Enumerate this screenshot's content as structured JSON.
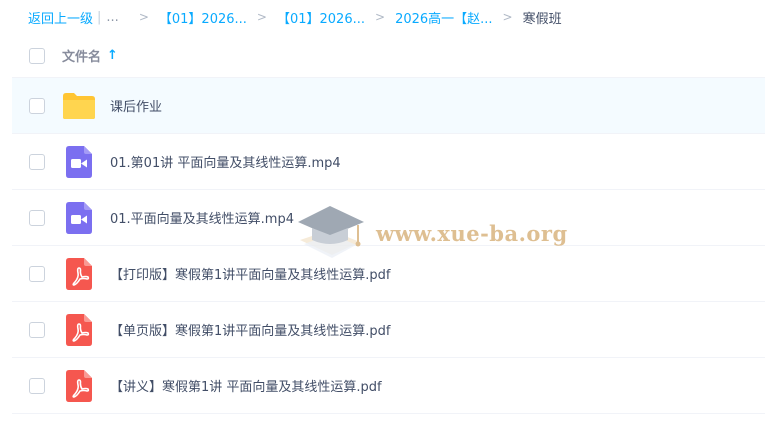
{
  "breadcrumb": {
    "back_label": "返回上一级",
    "divider": "|",
    "ellipsis": "...",
    "separator": ">",
    "items": [
      "【01】2026...",
      "【01】2026...",
      "2026高一【赵..."
    ],
    "current": "寒假班"
  },
  "list_header": {
    "name_label": "文件名",
    "sort_arrow": "↑"
  },
  "files": [
    {
      "name": "课后作业",
      "type": "folder"
    },
    {
      "name": "01.第01讲 平面向量及其线性运算.mp4",
      "type": "video"
    },
    {
      "name": "01.平面向量及其线性运算.mp4",
      "type": "video"
    },
    {
      "name": "【打印版】寒假第1讲平面向量及其线性运算.pdf",
      "type": "pdf"
    },
    {
      "name": "【单页版】寒假第1讲平面向量及其线性运算.pdf",
      "type": "pdf"
    },
    {
      "name": "【讲义】寒假第1讲 平面向量及其线性运算.pdf",
      "type": "pdf"
    }
  ],
  "watermark": {
    "text": "www.xue-ba.org"
  },
  "colors": {
    "accent": "#09aaff",
    "folder": "#ffc533",
    "video": "#7b6ff0",
    "pdf": "#f5574f",
    "hover_row": "#f4fbff"
  }
}
